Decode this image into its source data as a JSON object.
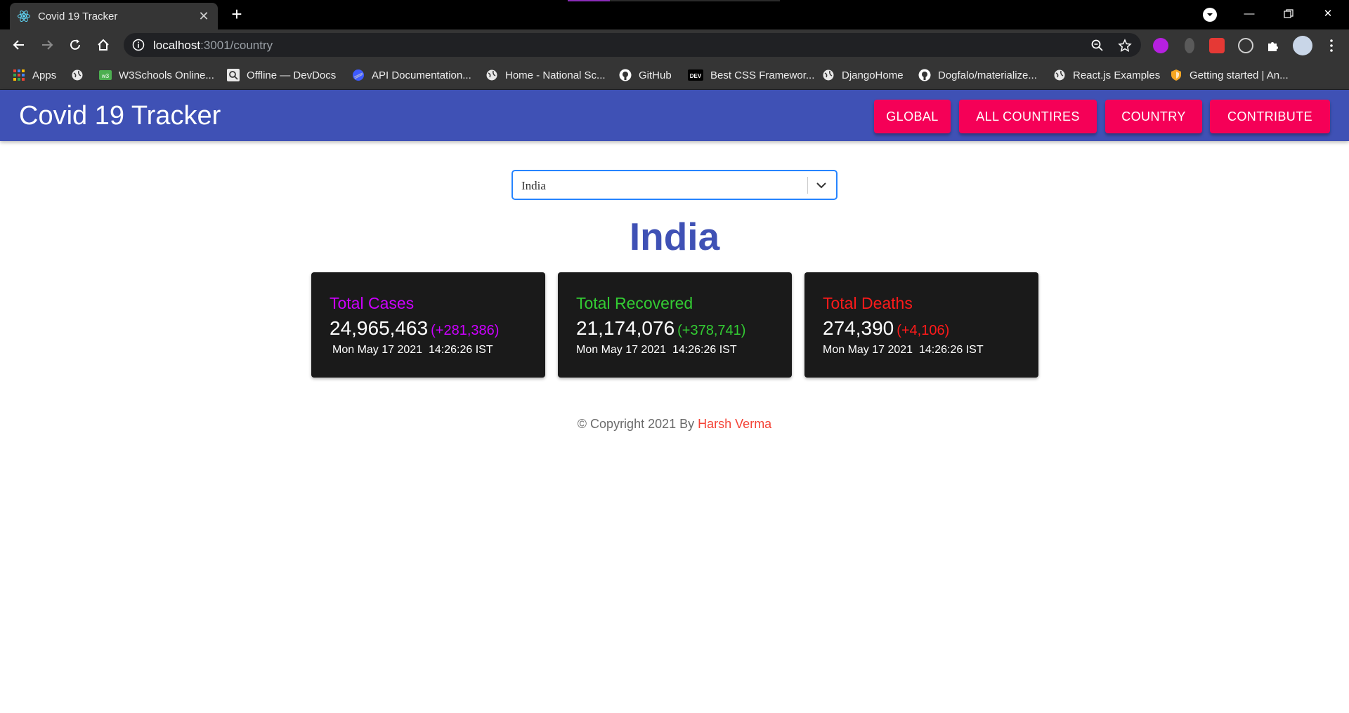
{
  "browser": {
    "tab_title": "Covid 19 Tracker",
    "url_host": "localhost",
    "url_rest": ":3001/country",
    "bookmarks": [
      {
        "label": "Apps",
        "icon": "apps-grid-icon"
      },
      {
        "label": "",
        "icon": "globe-icon"
      },
      {
        "label": "W3Schools Online...",
        "icon": "w3schools-icon"
      },
      {
        "label": "Offline — DevDocs",
        "icon": "devdocs-icon"
      },
      {
        "label": "API Documentation...",
        "icon": "api-docs-icon"
      },
      {
        "label": "Home - National Sc...",
        "icon": "globe-icon"
      },
      {
        "label": "GitHub",
        "icon": "github-icon"
      },
      {
        "label": "Best CSS Framewor...",
        "icon": "dev-icon"
      },
      {
        "label": "DjangoHome",
        "icon": "globe-icon"
      },
      {
        "label": "Dogfalo/materialize...",
        "icon": "github-icon"
      },
      {
        "label": "React.js Examples",
        "icon": "globe-icon"
      },
      {
        "label": "Getting started | An...",
        "icon": "shield-icon"
      }
    ]
  },
  "app": {
    "title": "Covid 19 Tracker",
    "nav": [
      {
        "label": "GLOBAL"
      },
      {
        "label": "ALL COUNTIRES"
      },
      {
        "label": "COUNTRY"
      },
      {
        "label": "CONTRIBUTE"
      }
    ],
    "country_select": {
      "value": "India"
    },
    "heading": "India",
    "cards": [
      {
        "label": "Total Cases",
        "value": "24,965,463",
        "delta": "(+281,386)",
        "date": "Mon May 17 2021  14:26:26 IST",
        "color": "#cc00ff"
      },
      {
        "label": "Total Recovered",
        "value": "21,174,076",
        "delta": "(+378,741)",
        "date": "Mon May 17 2021  14:26:26 IST",
        "color": "#33cc33"
      },
      {
        "label": "Total Deaths",
        "value": "274,390",
        "delta": "(+4,106)",
        "date": "Mon May 17 2021  14:26:26 IST",
        "color": "#ff1a1a"
      }
    ],
    "footer": {
      "text": "© Copyright 2021 By",
      "author": "Harsh Verma"
    }
  },
  "colors": {
    "appbar": "#3f51b5",
    "accent": "#f50057",
    "heading": "#3f51b5",
    "card_bg": "#1a1a1a"
  }
}
